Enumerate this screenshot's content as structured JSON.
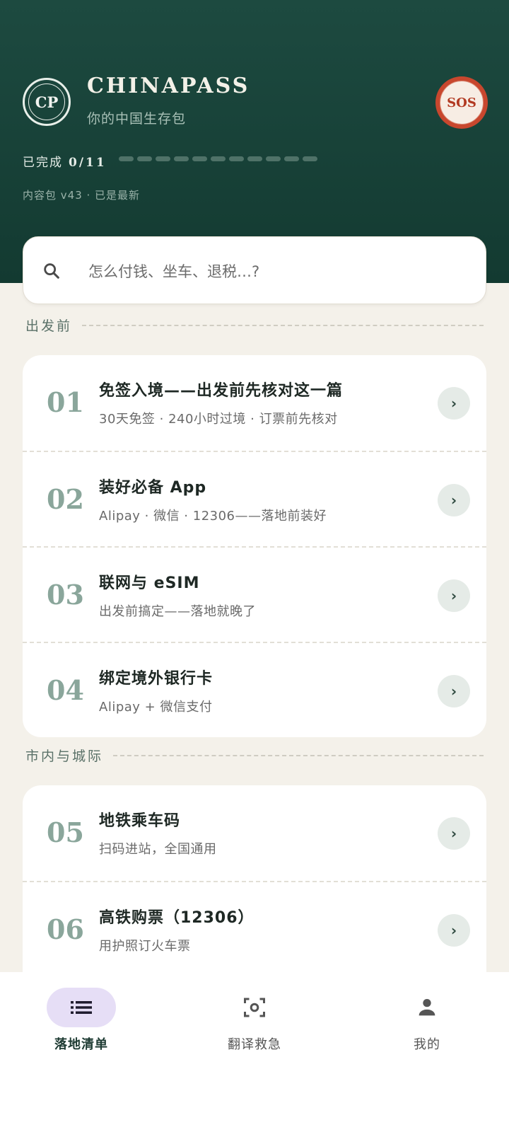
{
  "header": {
    "logo_text": "CP",
    "app_title": "CHINAPASS",
    "app_subtitle": "你的中国生存包",
    "sos_label": "SOS",
    "progress_label": "已完成",
    "progress_count": "0/11",
    "progress": {
      "completed": 0,
      "total": 11
    },
    "content_version": "内容包 v43 · 已是最新"
  },
  "search": {
    "placeholder": "怎么付钱、坐车、退税…?"
  },
  "sections": [
    {
      "title": "出发前",
      "items": [
        {
          "num": "01",
          "title": "免签入境——出发前先核对这一篇",
          "subtitle": "30天免签 · 240小时过境 · 订票前先核对"
        },
        {
          "num": "02",
          "title": "装好必备 App",
          "subtitle": "Alipay · 微信 · 12306——落地前装好"
        },
        {
          "num": "03",
          "title": "联网与 eSIM",
          "subtitle": "出发前搞定——落地就晚了"
        },
        {
          "num": "04",
          "title": "绑定境外银行卡",
          "subtitle": "Alipay + 微信支付"
        }
      ]
    },
    {
      "title": "市内与城际",
      "items": [
        {
          "num": "05",
          "title": "地铁乘车码",
          "subtitle": "扫码进站，全国通用"
        },
        {
          "num": "06",
          "title": "高铁购票（12306）",
          "subtitle": "用护照订火车票"
        }
      ]
    }
  ],
  "chevron": "›",
  "bottom_nav": [
    {
      "label": "落地清单",
      "icon": "list-icon",
      "active": true
    },
    {
      "label": "翻译救急",
      "icon": "camera-scan-icon",
      "active": false
    },
    {
      "label": "我的",
      "icon": "person-icon",
      "active": false
    }
  ],
  "colors": {
    "header_bg": "#1a4339",
    "accent_sos": "#c8472e",
    "page_bg": "#f4f1ea",
    "nav_active_pill": "#e6def6"
  }
}
